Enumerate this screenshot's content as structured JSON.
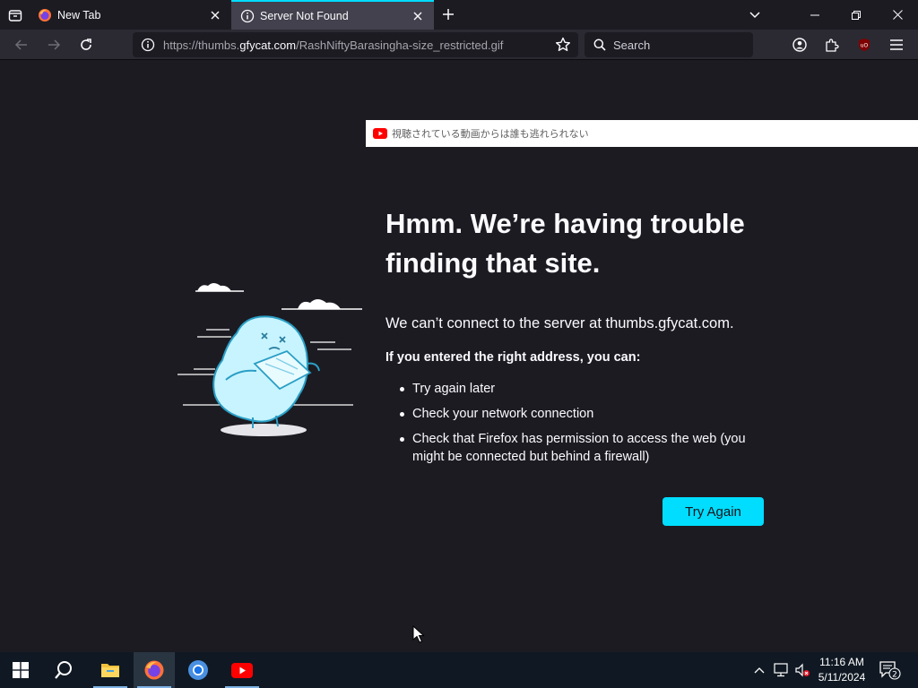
{
  "browser": {
    "tabs": [
      {
        "title": "New Tab",
        "icon": "firefox-icon",
        "active": false
      },
      {
        "title": "Server Not Found",
        "icon": "info-icon",
        "active": true
      }
    ],
    "url": {
      "prefix": "https://thumbs.",
      "host": "gfycat.com",
      "path": "/RashNiftyBarasingha-size_restricted.gif"
    },
    "search_placeholder": "Search",
    "accent": "#00ddff"
  },
  "overlay": {
    "youtube_text": "視聴されている動画からは誰も逃れられない"
  },
  "error_page": {
    "title": "Hmm. We’re having trouble finding that site.",
    "description": "We can’t connect to the server at thumbs.gfycat.com.",
    "sub_heading": "If you entered the right address, you can:",
    "suggestions": [
      "Try again later",
      "Check your network connection",
      "Check that Firefox has permission to access the web (you might be connected but behind a firewall)"
    ],
    "button_label": "Try Again"
  },
  "taskbar": {
    "apps": [
      "start-icon",
      "search-icon",
      "file-explorer-icon",
      "firefox-icon",
      "chrome-icon",
      "youtube-icon"
    ],
    "time": "11:16 AM",
    "date": "5/11/2024",
    "notification_count": "2"
  }
}
